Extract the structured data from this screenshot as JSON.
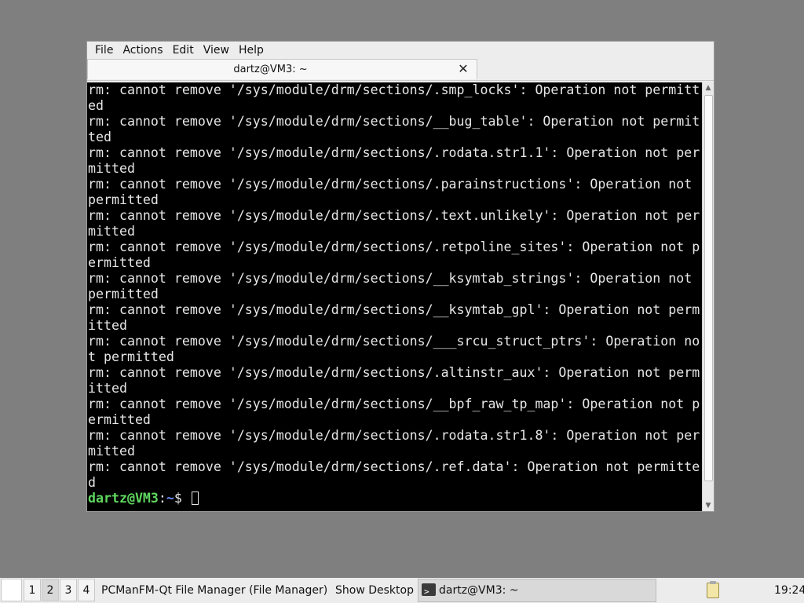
{
  "menubar": {
    "items": [
      "File",
      "Actions",
      "Edit",
      "View",
      "Help"
    ]
  },
  "tab": {
    "title": "dartz@VM3: ~",
    "close_glyph": "✕"
  },
  "terminal": {
    "lines": [
      "rm: cannot remove '/sys/module/drm/sections/.smp_locks': Operation not permitt",
      "ed",
      "rm: cannot remove '/sys/module/drm/sections/__bug_table': Operation not permit",
      "ted",
      "rm: cannot remove '/sys/module/drm/sections/.rodata.str1.1': Operation not per",
      "mitted",
      "rm: cannot remove '/sys/module/drm/sections/.parainstructions': Operation not",
      "permitted",
      "rm: cannot remove '/sys/module/drm/sections/.text.unlikely': Operation not per",
      "mitted",
      "rm: cannot remove '/sys/module/drm/sections/.retpoline_sites': Operation not p",
      "ermitted",
      "rm: cannot remove '/sys/module/drm/sections/__ksymtab_strings': Operation not",
      "permitted",
      "rm: cannot remove '/sys/module/drm/sections/__ksymtab_gpl': Operation not perm",
      "itted",
      "rm: cannot remove '/sys/module/drm/sections/___srcu_struct_ptrs': Operation no",
      "t permitted",
      "rm: cannot remove '/sys/module/drm/sections/.altinstr_aux': Operation not perm",
      "itted",
      "rm: cannot remove '/sys/module/drm/sections/__bpf_raw_tp_map': Operation not p",
      "ermitted",
      "rm: cannot remove '/sys/module/drm/sections/.rodata.str1.8': Operation not per",
      "mitted",
      "rm: cannot remove '/sys/module/drm/sections/.ref.data': Operation not permitte",
      "d"
    ],
    "prompt": {
      "user_host": "dartz@VM3",
      "separator": ":",
      "path": "~",
      "symbol": "$ "
    },
    "colors": {
      "background": "#000000",
      "text": "#e6e6e6",
      "prompt_user": "#5fd75f",
      "prompt_path": "#6f8cff"
    }
  },
  "scrollbar": {
    "up_glyph": "▲",
    "down_glyph": "▼"
  },
  "taskbar": {
    "workspaces": [
      "1",
      "2",
      "3",
      "4"
    ],
    "active_workspace": "2",
    "file_manager_label": "PCManFM-Qt File Manager (File Manager)",
    "show_desktop_label": "Show Desktop",
    "active_task_label": "dartz@VM3: ~",
    "clock": "19:24"
  }
}
